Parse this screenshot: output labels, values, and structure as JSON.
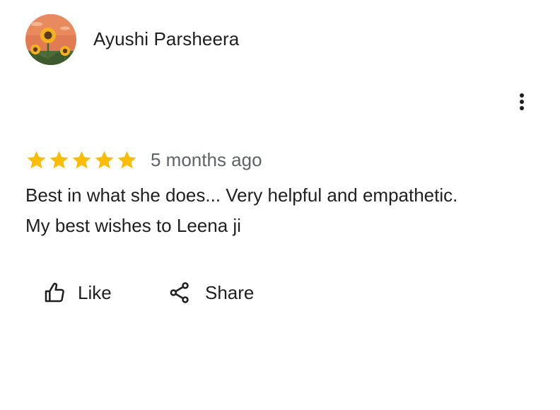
{
  "reviewer": {
    "name": "Ayushi Parsheera",
    "avatar_icon": "sunflower-avatar"
  },
  "review": {
    "rating": 5,
    "rating_max": 5,
    "star_color": "#fbbc04",
    "date": "5 months ago",
    "lines": [
      "Best in what she does... Very helpful and empathetic.",
      "My best wishes to Leena ji"
    ]
  },
  "menu": {
    "icon": "more-vert-icon"
  },
  "actions": {
    "like_label": "Like",
    "like_icon": "thumbs-up-icon",
    "share_label": "Share",
    "share_icon": "share-icon"
  }
}
